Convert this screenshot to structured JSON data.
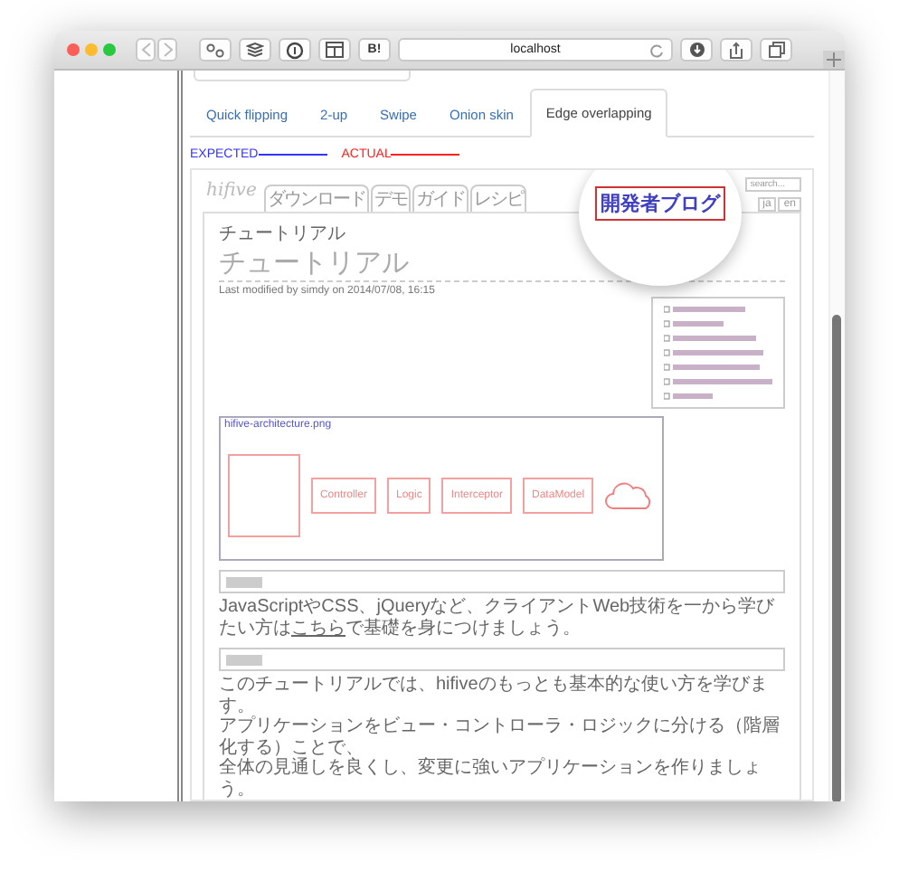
{
  "browser": {
    "address": "localhost",
    "bookmark_button": "B!"
  },
  "diff_tabs": [
    {
      "label": "Quick flipping",
      "selected": false
    },
    {
      "label": "2-up",
      "selected": false
    },
    {
      "label": "Swipe",
      "selected": false
    },
    {
      "label": "Onion skin",
      "selected": false
    },
    {
      "label": "Edge overlapping",
      "selected": true
    }
  ],
  "legend": [
    {
      "label": "EXPECTED",
      "color": "#3333ff"
    },
    {
      "label": "ACTUAL",
      "color": "#ff2020"
    }
  ],
  "snapshot": {
    "logo": "hifive",
    "nav": [
      "ダウンロード",
      "デモ",
      "ガイド",
      "レシピ"
    ],
    "search_placeholder": "search...",
    "languages": [
      "ja",
      "en"
    ],
    "magnified_text": "開発者ブログ",
    "breadcrumb": "チュートリアル",
    "title": "チュートリアル",
    "modified": "Last modified by simdy on 2014/07/08, 16:15",
    "diagram": {
      "caption": "hifive-architecture.png",
      "labels": [
        "Controller",
        "Logic",
        "Interceptor",
        "DataModel"
      ]
    },
    "paragraphs": [
      {
        "before": "JavaScriptやCSS、jQueryなど、クライアントWeb技術を一から学びたい方は",
        "link": "こちら",
        "after": "で基礎を身につけましょう。"
      },
      {
        "lines": [
          "このチュートリアルでは、hifiveのもっとも基本的な使い方を学びます。",
          "アプリケーションをビュー・コントローラ・ロジックに分ける（階層化する）ことで、",
          "全体の見通しを良くし、変更に強いアプリケーションを作りましょう。"
        ]
      }
    ]
  }
}
